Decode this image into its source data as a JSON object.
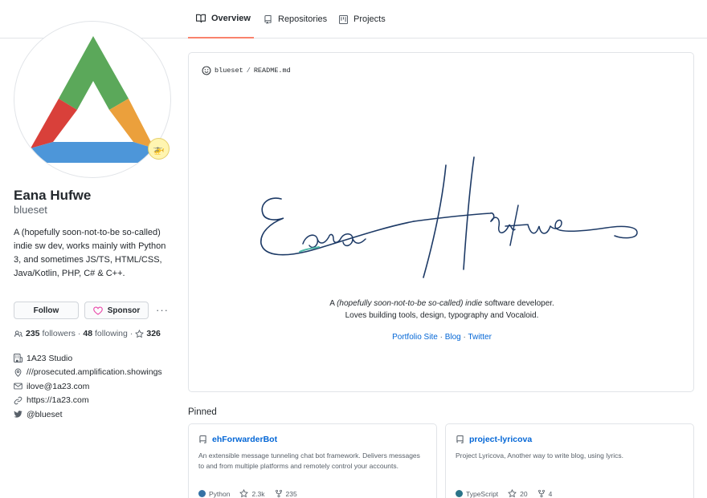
{
  "colors": {
    "accent_tab": "#f9826c",
    "link": "#0366d6",
    "python": "#3572A5",
    "typescript": "#2b7489",
    "sponsor_heart": "#ea4aaa",
    "signature_ink": "#1d3a66",
    "signature_teal": "#4fb8a8"
  },
  "tabs": [
    {
      "label": "Overview",
      "icon": "book-icon"
    },
    {
      "label": "Repositories",
      "icon": "repo-icon"
    },
    {
      "label": "Projects",
      "icon": "project-icon"
    }
  ],
  "profile": {
    "name": "Eana Hufwe",
    "login": "blueset",
    "status_emoji": "🚁",
    "bio": "A (hopefully soon-not-to-be so-called) indie sw dev, works mainly with Python 3, and sometimes JS/TS, HTML/CSS, Java/Kotlin, PHP, C# & C++.",
    "follow_label": "Follow",
    "sponsor_label": "Sponsor",
    "more_label": "···",
    "followers_count": "235",
    "followers_label": "followers",
    "following_count": "48",
    "following_label": "following",
    "stars_count": "326",
    "separator": "·",
    "company": "1A23 Studio",
    "location": "///prosecuted.amplification.showings",
    "email": "ilove@1a23.com",
    "website": "https://1a23.com",
    "twitter": "@blueset"
  },
  "readme": {
    "owner": "blueset",
    "slash": "/",
    "file": "README.md",
    "signature_alt": "Eana Hufwe",
    "tagline_prefix": "A",
    "tagline_italic": "(hopefully soon-not-to-be so-called) indie",
    "tagline_suffix": "software developer.",
    "tagline_line2": "Loves building tools, design, typography and Vocaloid.",
    "links": [
      "Portfolio Site",
      "Blog",
      "Twitter"
    ],
    "link_separator": "·"
  },
  "pinned": {
    "title": "Pinned",
    "repos": [
      {
        "name": "ehForwarderBot",
        "description": "An extensible message tunneling chat bot framework. Delivers messages to and from multiple platforms and remotely control your accounts.",
        "language": "Python",
        "stars": "2.3k",
        "forks": "235"
      },
      {
        "name": "project-lyricova",
        "description": "Project Lyricova, Another way to write blog, using lyrics.",
        "language": "TypeScript",
        "stars": "20",
        "forks": "4"
      }
    ]
  }
}
